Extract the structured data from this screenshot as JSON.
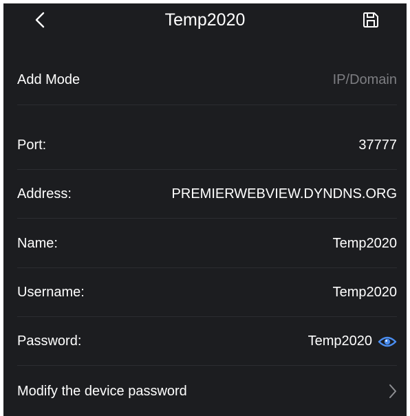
{
  "header": {
    "title": "Temp2020",
    "back_icon": "chevron-left-icon",
    "save_icon": "save-icon"
  },
  "rows": {
    "add_mode": {
      "label": "Add Mode",
      "value": "IP/Domain"
    },
    "port": {
      "label": "Port:",
      "value": "37777"
    },
    "address": {
      "label": "Address:",
      "value": "PREMIERWEBVIEW.DYNDNS.ORG"
    },
    "name": {
      "label": "Name:",
      "value": "Temp2020"
    },
    "username": {
      "label": "Username:",
      "value": "Temp2020"
    },
    "password": {
      "label": "Password:",
      "value": "Temp2020",
      "toggle_icon": "eye-icon"
    },
    "modify_password": {
      "label": "Modify the device password",
      "icon": "chevron-right-icon"
    }
  },
  "colors": {
    "background": "#1c1d20",
    "text": "#ffffff",
    "muted_text": "#7d7e82",
    "divider": "#2c2d31",
    "accent": "#4a8df0"
  }
}
